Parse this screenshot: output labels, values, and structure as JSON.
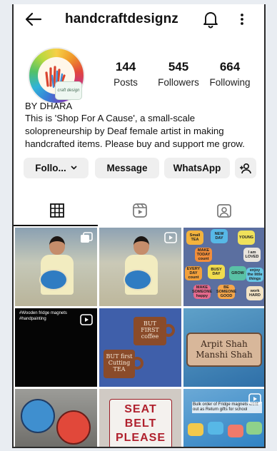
{
  "header": {
    "username": "handcraftdesignz",
    "back_icon": "back-arrow-icon",
    "notifications_icon": "bell-icon",
    "more_icon": "more-vertical-icon"
  },
  "profile": {
    "avatar_badge": "craft design",
    "stats": {
      "posts": {
        "value": "144",
        "label": "Posts"
      },
      "followers": {
        "value": "545",
        "label": "Followers"
      },
      "following": {
        "value": "664",
        "label": "Following"
      }
    },
    "name": "BY DHARA",
    "bio": "This is 'Shop For A Cause', a small-scale solopreneurship by Deaf female artist in making handcrafted items. Please buy and support me grow."
  },
  "actions": {
    "follow_label": "Follo...",
    "message_label": "Message",
    "whatsapp_label": "WhatsApp",
    "add_user_icon": "add-person-icon"
  },
  "tabs": [
    {
      "name": "posts",
      "icon": "grid-icon",
      "active": true
    },
    {
      "name": "reels",
      "icon": "reels-icon",
      "active": false
    },
    {
      "name": "tagged",
      "icon": "tagged-icon",
      "active": false
    }
  ],
  "posts": {
    "t3_tags": [
      "Small TEA",
      "NEW DAY",
      "YOUNG",
      "MAKE TODAY count",
      "I am LOVED",
      "EVERY DAY count",
      "BUSY DAY",
      "GROW",
      "MAKE SOMEONE happy",
      "BE SOMEONE GOOD",
      "enjoy the little things",
      "work HARD"
    ],
    "t4_caption": "#Wooden fridge magnets\n#handpainting",
    "t5_mug1": "BUT FIRST coffee",
    "t5_mug2": "BUT first Cutting TEA",
    "t6_line1": "Arpit Shah",
    "t6_line2": "Manshi Shah",
    "t8_sign": "SEAT BELT PLEASE",
    "t9_caption": "Bulk order of Fridge magnets went out as Return gifts for school"
  },
  "colors": {
    "accent_text": "#111111",
    "button_bg": "#efefef"
  }
}
